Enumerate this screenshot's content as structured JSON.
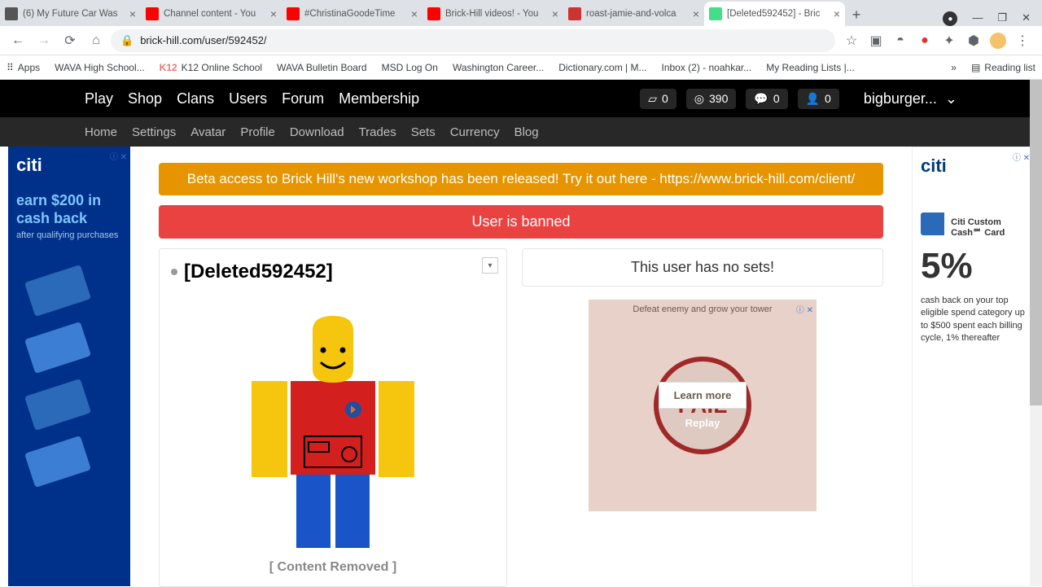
{
  "browser": {
    "tabs": [
      {
        "title": "(6) My Future Car Was",
        "favColor": "#555"
      },
      {
        "title": "Channel content - You",
        "favColor": "#f00"
      },
      {
        "title": "#ChristinaGoodeTime",
        "favColor": "#f00"
      },
      {
        "title": "Brick-Hill videos! - You",
        "favColor": "#f00"
      },
      {
        "title": "roast-jamie-and-volca",
        "favColor": "#c33"
      },
      {
        "title": "[Deleted592452] - Bric",
        "favColor": "#4d8",
        "active": true
      }
    ],
    "url": "brick-hill.com/user/592452/",
    "bookmarks": [
      "Apps",
      "WAVA High School...",
      "K12 Online School",
      "WAVA Bulletin Board",
      "MSD Log On",
      "Washington Career...",
      "Dictionary.com | M...",
      "Inbox (2) - noahkar...",
      "My Reading Lists |..."
    ],
    "bookmarkTail": "Reading list"
  },
  "site": {
    "mainNav": [
      "Play",
      "Shop",
      "Clans",
      "Users",
      "Forum",
      "Membership"
    ],
    "stats": {
      "bucks": "0",
      "bits": "390",
      "msgs": "0",
      "friends": "0"
    },
    "username": "bigburger...",
    "subNav": [
      "Home",
      "Settings",
      "Avatar",
      "Profile",
      "Download",
      "Trades",
      "Sets",
      "Currency",
      "Blog"
    ]
  },
  "banners": {
    "beta": "Beta access to Brick Hill's new workshop has been released! Try it out here - https://www.brick-hill.com/client/",
    "banned": "User is banned"
  },
  "profile": {
    "name": "[Deleted592452]",
    "contentRemoved": "[ Content Removed ]",
    "noSets": "This user has no sets!"
  },
  "ads": {
    "citi": "citi",
    "left": {
      "headline": "earn $200 in cash back",
      "sub": "after qualifying purchases"
    },
    "right": {
      "title": "Citi Custom Cash℠ Card",
      "pct": "5%",
      "desc": "cash back on your top eligible spend category up to $500 spent each billing cycle, 1% thereafter"
    },
    "game": {
      "head": "Defeat enemy and grow your tower",
      "learn": "Learn more",
      "replay": "Replay",
      "fail": "FAIL"
    }
  }
}
